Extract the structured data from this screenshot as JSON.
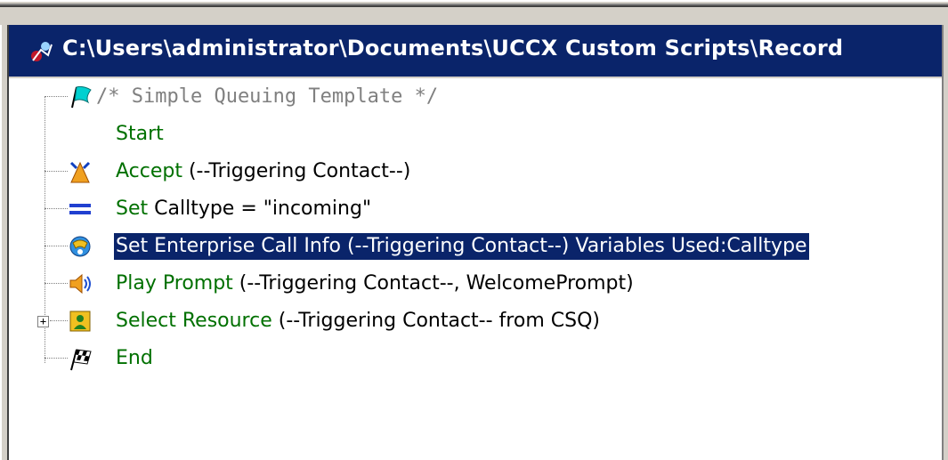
{
  "window": {
    "title": "C:\\Users\\administrator\\Documents\\UCCX Custom Scripts\\Record",
    "title_icon": "script-icon"
  },
  "tree": {
    "comment": "/* Simple Queuing Template */",
    "items": [
      {
        "keyword": "Start",
        "args": "",
        "icon": "none"
      },
      {
        "keyword": "Accept",
        "args": " (--Triggering Contact--)",
        "icon": "accept-icon"
      },
      {
        "keyword": "Set",
        "args": " Calltype = \"incoming\"",
        "icon": "set-icon"
      },
      {
        "keyword": "Set Enterprise Call Info",
        "args": " (--Triggering Contact--) Variables Used:Calltype",
        "icon": "enterprise-call-info-icon",
        "selected": true
      },
      {
        "keyword": "Play Prompt",
        "args": " (--Triggering Contact--, WelcomePrompt)",
        "icon": "speaker-icon"
      },
      {
        "keyword": "Select Resource",
        "args": " (--Triggering Contact-- from CSQ)",
        "icon": "agent-icon",
        "expander": "+"
      },
      {
        "keyword": "End",
        "args": "",
        "icon": "checkered-flag-icon"
      }
    ]
  },
  "colors": {
    "title_bg": "#0a246a",
    "keyword": "#007000",
    "comment": "#808080",
    "selection_bg": "#0a246a"
  }
}
